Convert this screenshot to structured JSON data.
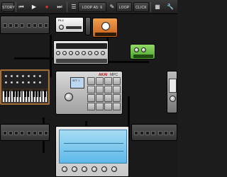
{
  "toolbar": {
    "history_label": "STORY",
    "loop_label": "LOOP A5: 6",
    "loop_button": "LOOP",
    "click_button": "CLICK",
    "prev_icon": "skip-back-icon",
    "play_icon": "play-icon",
    "record_icon": "record-icon",
    "next_icon": "skip-forward-icon",
    "settings_icon": "settings-icon",
    "pencil_icon": "pencil-icon",
    "grid_icon": "grid-icon",
    "wrench_icon": "wrench-icon"
  },
  "devices": {
    "fx_label": "FX-2",
    "mpc_brand": "AKAI",
    "mpc_model": "MPC",
    "mpc_screen": "SET: 1"
  },
  "colors": {
    "toolbar_bg": "#2a2a2a",
    "canvas_bg": "#1a1a1a",
    "orange_device": "#e07a2a",
    "green_device": "#6cc24a",
    "sampler_blue": "#5db8e8",
    "synth_wood": "#a26f3a"
  }
}
